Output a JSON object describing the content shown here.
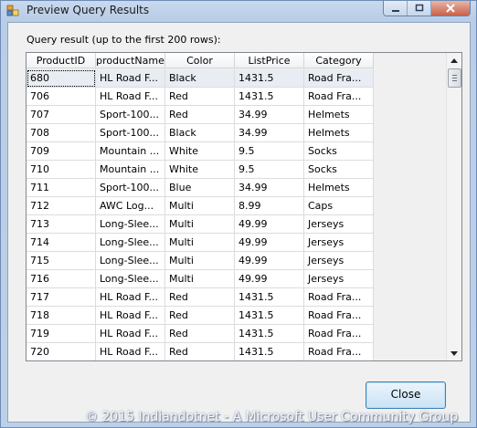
{
  "window": {
    "title": "Preview Query Results"
  },
  "caption": "Query result (up to the first 200 rows):",
  "table": {
    "columns": [
      "ProductID",
      "productName",
      "Color",
      "ListPrice",
      "Category"
    ],
    "rows": [
      [
        "680",
        "HL Road F...",
        "Black",
        "1431.5",
        "Road Fra..."
      ],
      [
        "706",
        "HL Road F...",
        "Red",
        "1431.5",
        "Road Fra..."
      ],
      [
        "707",
        "Sport-100...",
        "Red",
        "34.99",
        "Helmets"
      ],
      [
        "708",
        "Sport-100...",
        "Black",
        "34.99",
        "Helmets"
      ],
      [
        "709",
        "Mountain ...",
        "White",
        "9.5",
        "Socks"
      ],
      [
        "710",
        "Mountain ...",
        "White",
        "9.5",
        "Socks"
      ],
      [
        "711",
        "Sport-100...",
        "Blue",
        "34.99",
        "Helmets"
      ],
      [
        "712",
        "AWC Log...",
        "Multi",
        "8.99",
        "Caps"
      ],
      [
        "713",
        "Long-Slee...",
        "Multi",
        "49.99",
        "Jerseys"
      ],
      [
        "714",
        "Long-Slee...",
        "Multi",
        "49.99",
        "Jerseys"
      ],
      [
        "715",
        "Long-Slee...",
        "Multi",
        "49.99",
        "Jerseys"
      ],
      [
        "716",
        "Long-Slee...",
        "Multi",
        "49.99",
        "Jerseys"
      ],
      [
        "717",
        "HL Road F...",
        "Red",
        "1431.5",
        "Road Fra..."
      ],
      [
        "718",
        "HL Road F...",
        "Red",
        "1431.5",
        "Road Fra..."
      ],
      [
        "719",
        "HL Road F...",
        "Red",
        "1431.5",
        "Road Fra..."
      ],
      [
        "720",
        "HL Road F...",
        "Red",
        "1431.5",
        "Road Fra..."
      ]
    ],
    "selected_row": 0
  },
  "buttons": {
    "close": "Close"
  },
  "icons": {
    "title": "window-app-icon",
    "minimize": "minimize-icon",
    "maximize": "maximize-icon",
    "close": "close-x-icon",
    "scroll_up": "scroll-up-arrow-icon",
    "scroll_down": "scroll-down-arrow-icon"
  },
  "watermark": "© 2015 Indiandotnet - A Microsoft User Community Group",
  "colors": {
    "frame": "#bcd0e8",
    "selection": "#e8ecf3",
    "button_border": "#3c7fb1"
  }
}
